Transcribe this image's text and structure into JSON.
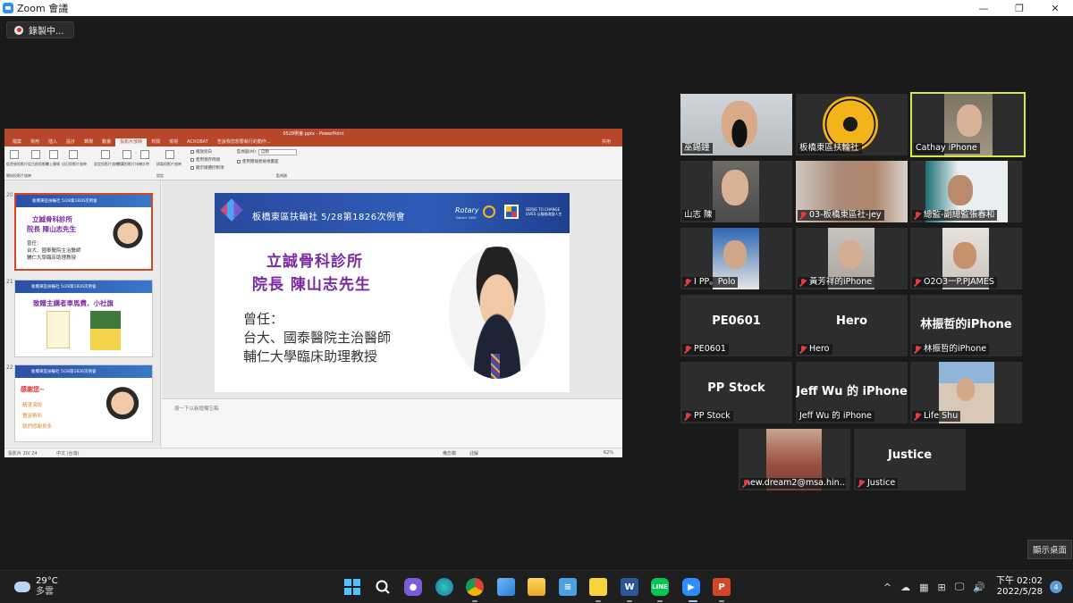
{
  "window": {
    "title": "Zoom 會議",
    "minimize": "—",
    "maximize": "❐",
    "close": "✕"
  },
  "recording": {
    "label": "錄製中..."
  },
  "ppt": {
    "title": "0528例會.pptx - PowerPoint",
    "menu": [
      "檔案",
      "常用",
      "插入",
      "設計",
      "轉場",
      "動畫",
      "投影片放映",
      "校閱",
      "檢視",
      "ACROBAT",
      "告訴我您想要執行的動作..."
    ],
    "active_menu_index": 6,
    "share_label": "共用",
    "ribbon": {
      "buttons": [
        "從首張投影片",
        "從目前投影片",
        "線上簡報",
        "自訂投影片放映",
        "設定投影片放映",
        "隱藏投影片",
        "排練計時",
        "錄製投影片放映"
      ],
      "checks": [
        "播放旁白",
        "使用預存時間",
        "顯示媒體控制項"
      ],
      "monitor_label": "監視器(M):",
      "monitor_value": "自動",
      "presenter_view": "使用簡報者檢視畫面",
      "groups": [
        "開始投影片放映",
        "設定",
        "監視器"
      ]
    },
    "thumbnails": [
      {
        "num": "20",
        "band": "板橋東區扶輪社  5/28第1826次例會",
        "title1": "立誠骨科診所",
        "title2": "院長  陳山志先生",
        "lines": [
          "曾任：",
          "台大、國泰醫院主治醫師",
          "輔仁大學臨床助理教授"
        ]
      },
      {
        "num": "21",
        "band": "板橋東區扶輪社  5/28第1826次例會",
        "title1": "致贈主講者車馬費、小社旗"
      },
      {
        "num": "22",
        "band": "板橋東區扶輪社  5/28第1826次例會",
        "title1": "感謝您~",
        "lines": [
          "精湛演說",
          "豐富精彩",
          "我們感謝良多"
        ]
      }
    ],
    "slide": {
      "band_title": "板橋東區扶輪社  5/28第1826次例會",
      "rotary": "Rotary",
      "district": "District 3490",
      "serve": "SERVE TO CHANGE LIVES",
      "serve_sub": "以服務改變人生",
      "heading1": "立誠骨科診所",
      "heading2": "院長  陳山志先生",
      "line1": "曾任：",
      "line2": "台大、國泰醫院主治醫師",
      "line3": "輔仁大學臨床助理教授"
    },
    "notes_placeholder": "按一下以新增備忘稿",
    "status": {
      "slide_count": "投影片 20/ 24",
      "language": "中文 (台灣)",
      "notes": "備忘稿",
      "comments": "註解",
      "zoom": "62%"
    }
  },
  "participants": [
    {
      "name": "巫錫鐘",
      "muted": false,
      "has_video": true
    },
    {
      "name": "板橋東區扶輪社",
      "muted": false,
      "has_video": true
    },
    {
      "name": "Cathay iPhone",
      "muted": false,
      "has_video": true,
      "speaking": true
    },
    {
      "name": "山志 陳",
      "muted": false,
      "has_video": true
    },
    {
      "name": "03-板橋東區社-jey",
      "muted": true,
      "has_video": true
    },
    {
      "name": "總監-副總監張春和",
      "muted": true,
      "has_video": true
    },
    {
      "name": "I PP。Polo",
      "muted": true,
      "has_video": true
    },
    {
      "name": "黃芳祥的iPhone",
      "muted": true,
      "has_video": true
    },
    {
      "name": "O2O3一P.PJAMES",
      "muted": true,
      "has_video": true
    },
    {
      "name": "PE0601",
      "muted": true,
      "has_video": false,
      "display": "PE0601"
    },
    {
      "name": "Hero",
      "muted": true,
      "has_video": false,
      "display": "Hero"
    },
    {
      "name": "林振哲的iPhone",
      "muted": true,
      "has_video": false,
      "display": "林振哲的iPhone"
    },
    {
      "name": "PP Stock",
      "muted": true,
      "has_video": false,
      "display": "PP Stock"
    },
    {
      "name": "Jeff Wu 的 iPhone",
      "muted": false,
      "has_video": false,
      "display": "Jeff Wu 的 iPhone"
    },
    {
      "name": "Life Shu",
      "muted": true,
      "has_video": true
    },
    {
      "name": "new.dream2@msa.hin...",
      "muted": true,
      "has_video": true
    },
    {
      "name": "Justice",
      "muted": true,
      "has_video": false,
      "display": "Justice"
    }
  ],
  "show_desktop": "顯示桌面",
  "taskbar": {
    "weather_temp": "29°C",
    "weather_cond": "多雲",
    "apps": [
      "windows-start",
      "search",
      "teams-chat",
      "edge",
      "chrome",
      "photos",
      "file-explorer",
      "notepad",
      "sticky-notes",
      "word",
      "line",
      "zoom",
      "powerpoint"
    ],
    "tray": [
      "^",
      "☁",
      "▦",
      "⊞",
      "🖵",
      "🔊"
    ],
    "time": "下午 02:02",
    "date": "2022/5/28",
    "notifications": "4"
  }
}
